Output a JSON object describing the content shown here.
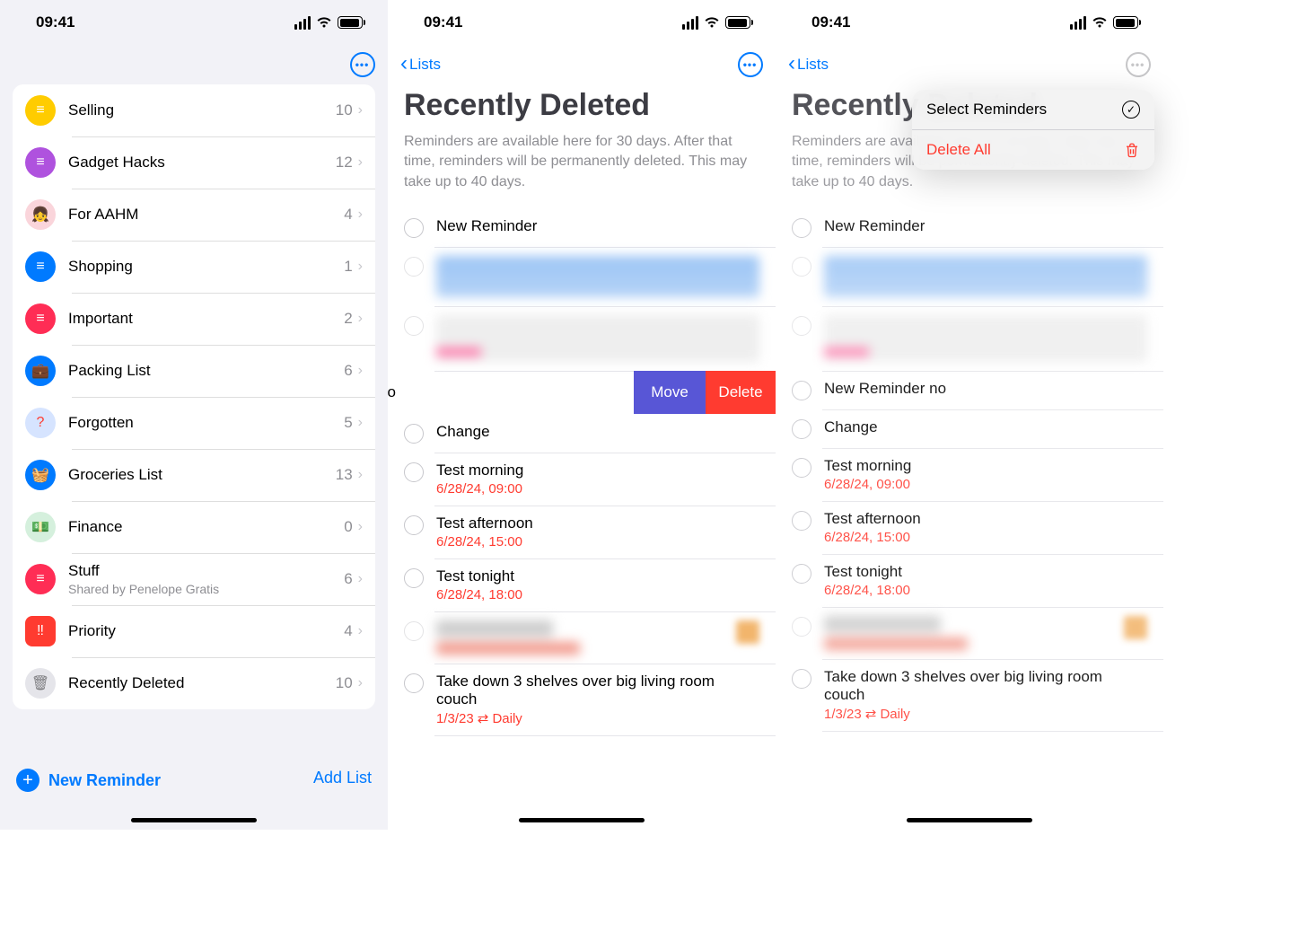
{
  "status": {
    "time": "09:41"
  },
  "phone1": {
    "lists": [
      {
        "name": "Selling",
        "count": "10",
        "iconClass": "ic-yellow",
        "icon": "≡"
      },
      {
        "name": "Gadget Hacks",
        "count": "12",
        "iconClass": "ic-purple",
        "icon": "≡"
      },
      {
        "name": "For AAHM",
        "count": "4",
        "iconClass": "ic-pink",
        "icon": "👧"
      },
      {
        "name": "Shopping",
        "count": "1",
        "iconClass": "ic-blue",
        "icon": "≡"
      },
      {
        "name": "Important",
        "count": "2",
        "iconClass": "ic-red",
        "icon": "≡"
      },
      {
        "name": "Packing List",
        "count": "6",
        "iconClass": "ic-teal",
        "icon": "💼"
      },
      {
        "name": "Forgotten",
        "count": "5",
        "iconClass": "ic-lblue",
        "icon": "?"
      },
      {
        "name": "Groceries List",
        "count": "13",
        "iconClass": "ic-cyan",
        "icon": "🧺"
      },
      {
        "name": "Finance",
        "count": "0",
        "iconClass": "ic-green",
        "icon": "💵"
      },
      {
        "name": "Stuff",
        "count": "6",
        "iconClass": "ic-magenta",
        "icon": "≡",
        "sub": "Shared by Penelope Gratis"
      },
      {
        "name": "Priority",
        "count": "4",
        "iconClass": "ic-salmon",
        "icon": "‼"
      },
      {
        "name": "Recently Deleted",
        "count": "10",
        "iconClass": "ic-gray",
        "icon": "🗑"
      }
    ],
    "newReminder": "New Reminder",
    "addList": "Add List"
  },
  "deleted": {
    "back": "Lists",
    "title": "Recently Deleted",
    "subtitle": "Reminders are available here for 30 days. After that time, reminders will be permanently deleted. This may take up to 40 days.",
    "items_top": {
      "title": "New Reminder"
    },
    "swipe": {
      "partial": "no",
      "move": "Move",
      "delete": "Delete"
    },
    "item_no": {
      "title": "New Reminder no"
    },
    "items": [
      {
        "title": "Change",
        "meta": ""
      },
      {
        "title": "Test morning",
        "meta": "6/28/24, 09:00"
      },
      {
        "title": "Test afternoon",
        "meta": "6/28/24, 15:00"
      },
      {
        "title": "Test tonight",
        "meta": "6/28/24, 18:00"
      }
    ],
    "last": {
      "title": "Take down 3 shelves over big living room couch",
      "meta": "1/3/23",
      "repeat": "⇄ Daily"
    }
  },
  "menu": {
    "select": "Select Reminders",
    "deleteAll": "Delete All"
  }
}
